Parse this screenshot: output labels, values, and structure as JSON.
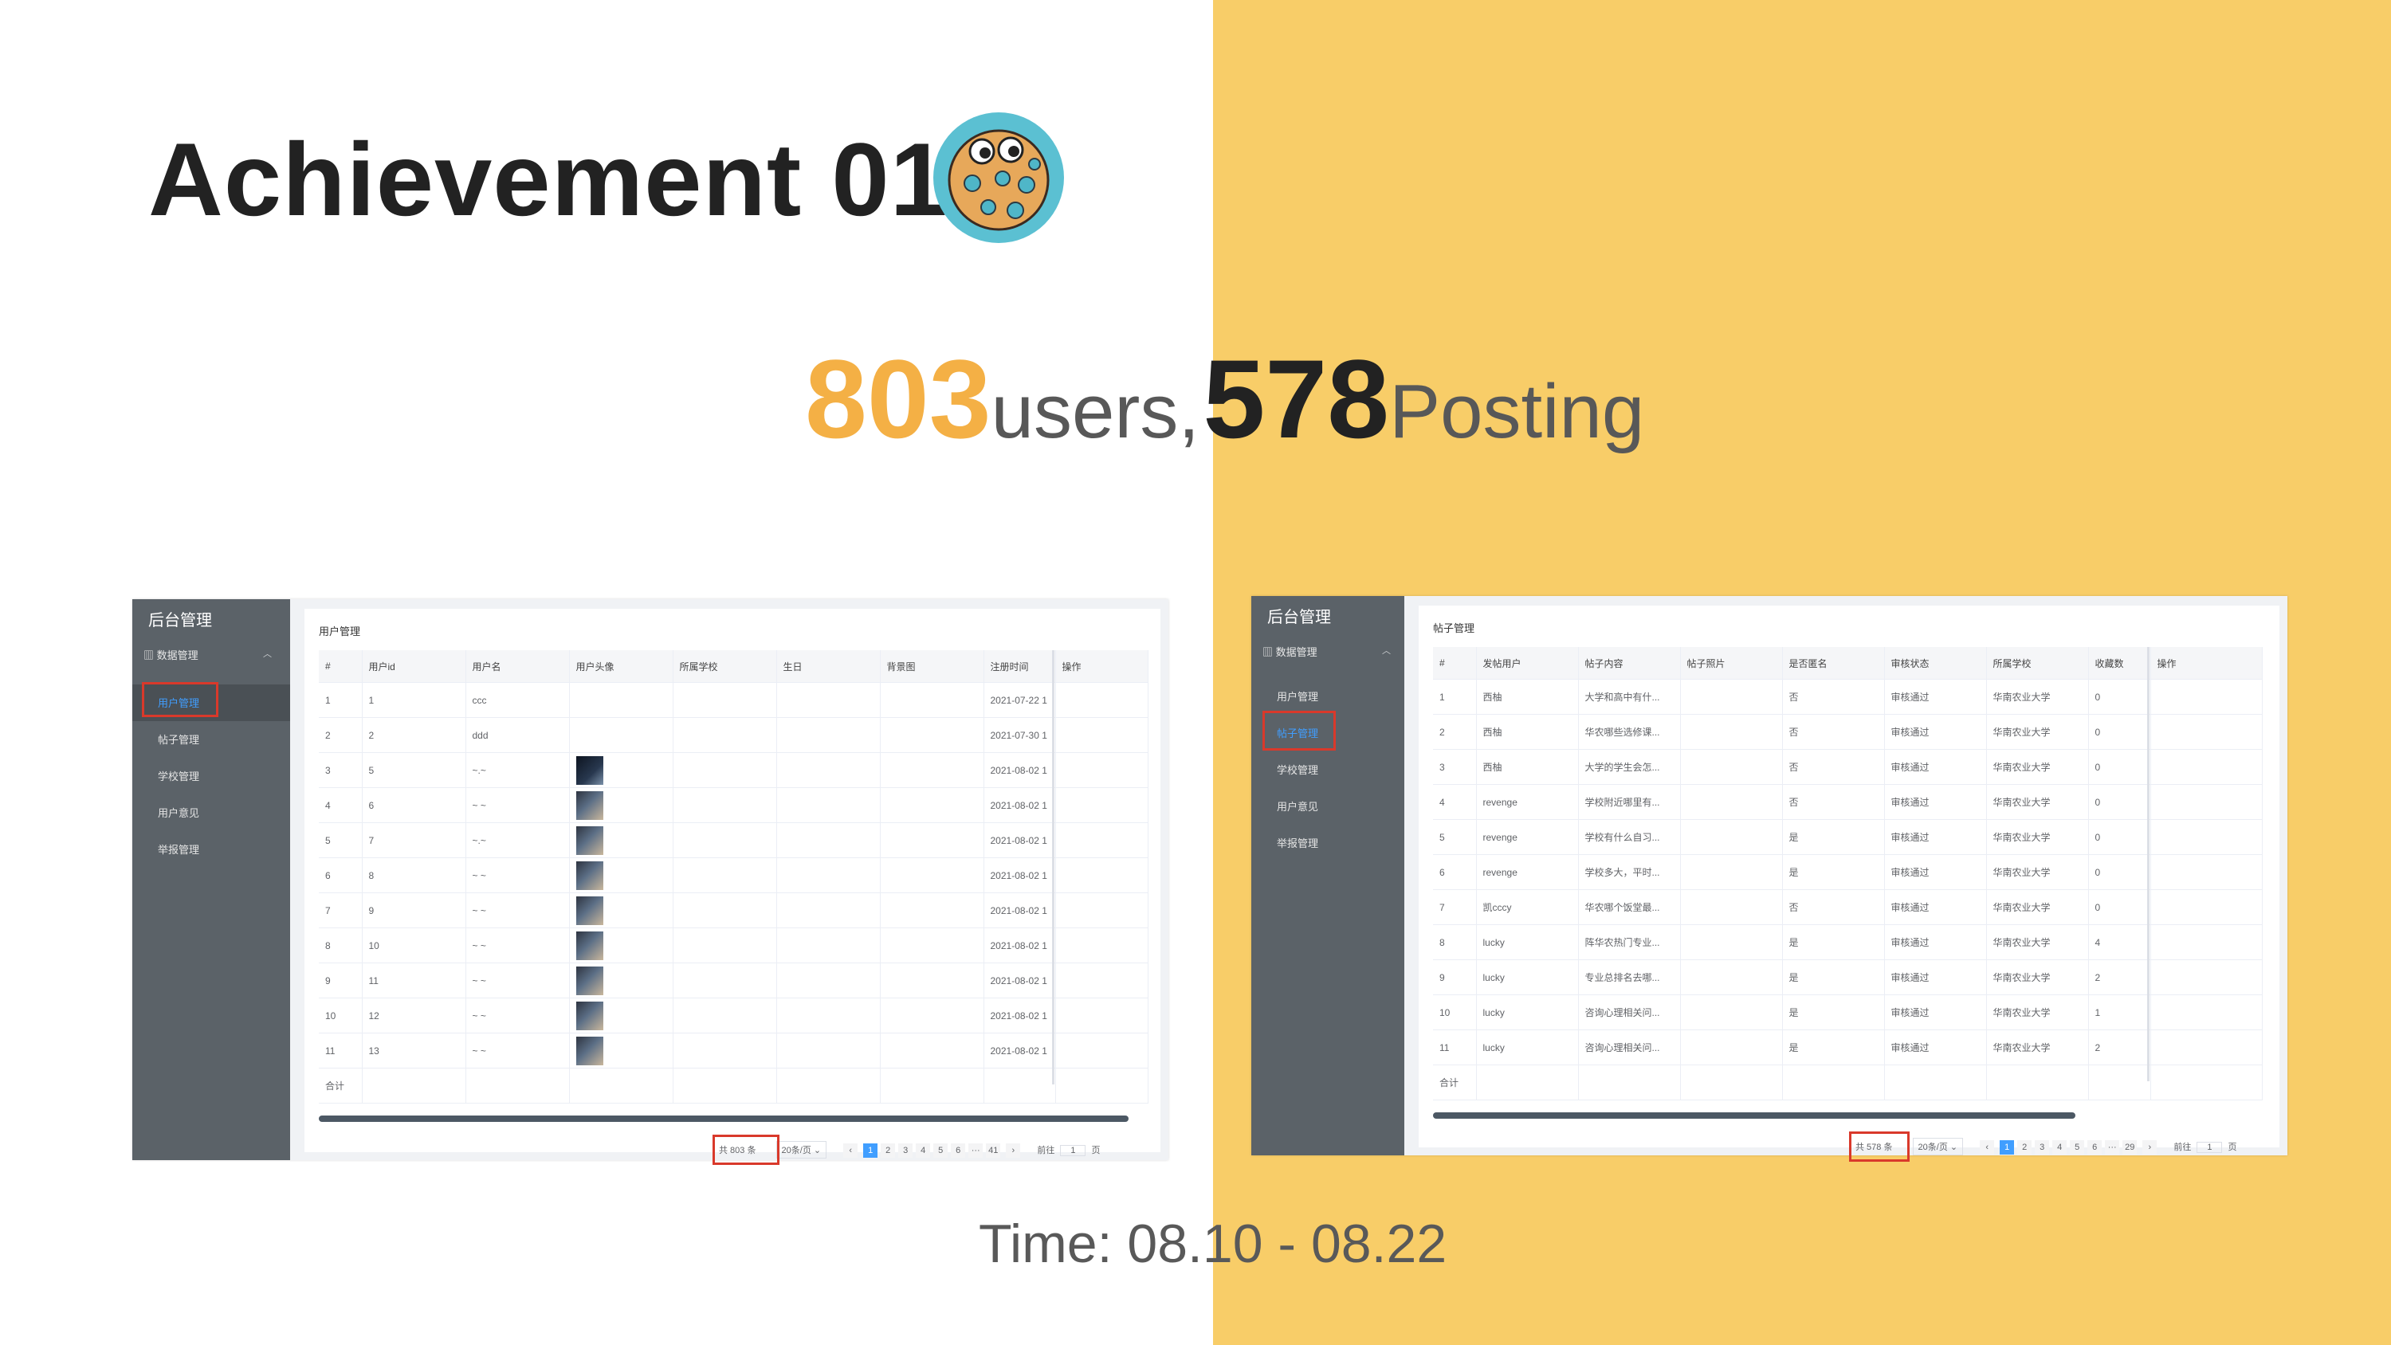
{
  "slide": {
    "title": "Achievement 01",
    "stat_users_value": "803",
    "stat_users_label": " users,",
    "stat_posts_value": "578",
    "stat_posts_label": "Posting",
    "time": "Time: 08.10 - 08.22"
  },
  "colors": {
    "accent_orange": "#f4b045",
    "bg_yellow": "#f8cd68",
    "sidebar": "#5b6268",
    "link_blue": "#409eff",
    "highlight_red": "#d9392b"
  },
  "user_panel": {
    "app_title": "后台管理",
    "group": "数据管理",
    "menu": [
      "用户管理",
      "帖子管理",
      "学校管理",
      "用户意见",
      "举报管理"
    ],
    "page_title": "用户管理",
    "columns": [
      "#",
      "用户id",
      "用户名",
      "用户头像",
      "所属学校",
      "生日",
      "背景图",
      "注册时间",
      "操作"
    ],
    "rows": [
      {
        "n": "1",
        "id": "1",
        "name": "ccc",
        "avatar": "",
        "time": "2021-07-22 1"
      },
      {
        "n": "2",
        "id": "2",
        "name": "ddd",
        "avatar": "",
        "time": "2021-07-30 1"
      },
      {
        "n": "3",
        "id": "5",
        "name": "~.~",
        "avatar": "dark",
        "time": "2021-08-02 1"
      },
      {
        "n": "4",
        "id": "6",
        "name": "~ ~",
        "avatar": "img",
        "time": "2021-08-02 1"
      },
      {
        "n": "5",
        "id": "7",
        "name": "~.~",
        "avatar": "img",
        "time": "2021-08-02 1"
      },
      {
        "n": "6",
        "id": "8",
        "name": "~ ~",
        "avatar": "img",
        "time": "2021-08-02 1"
      },
      {
        "n": "7",
        "id": "9",
        "name": "~ ~",
        "avatar": "img",
        "time": "2021-08-02 1"
      },
      {
        "n": "8",
        "id": "10",
        "name": "~ ~",
        "avatar": "img",
        "time": "2021-08-02 1"
      },
      {
        "n": "9",
        "id": "11",
        "name": "~ ~",
        "avatar": "img",
        "time": "2021-08-02 1"
      },
      {
        "n": "10",
        "id": "12",
        "name": "~ ~",
        "avatar": "img",
        "time": "2021-08-02 1"
      },
      {
        "n": "11",
        "id": "13",
        "name": "~ ~",
        "avatar": "img",
        "time": "2021-08-02 1"
      }
    ],
    "total_row": "合计",
    "pager": {
      "total": "共 803 条",
      "size": "20条/页",
      "pages": [
        "1",
        "2",
        "3",
        "4",
        "5",
        "6",
        "···",
        "41"
      ],
      "goto": "前往",
      "page_input": "1",
      "page_suffix": "页",
      "prev": "‹",
      "next": "›"
    }
  },
  "post_panel": {
    "app_title": "后台管理",
    "group": "数据管理",
    "menu": [
      "用户管理",
      "帖子管理",
      "学校管理",
      "用户意见",
      "举报管理"
    ],
    "page_title": "帖子管理",
    "columns": [
      "#",
      "发帖用户",
      "帖子内容",
      "帖子照片",
      "是否匿名",
      "审核状态",
      "所属学校",
      "收藏数",
      "操作"
    ],
    "rows": [
      {
        "n": "1",
        "user": "西柚",
        "content": "大学和高中有什...",
        "anon": "否",
        "status": "审核通过",
        "school": "华南农业大学",
        "fav": "0"
      },
      {
        "n": "2",
        "user": "西柚",
        "content": "华农哪些选修课...",
        "anon": "否",
        "status": "审核通过",
        "school": "华南农业大学",
        "fav": "0"
      },
      {
        "n": "3",
        "user": "西柚",
        "content": "大学的学生会怎...",
        "anon": "否",
        "status": "审核通过",
        "school": "华南农业大学",
        "fav": "0"
      },
      {
        "n": "4",
        "user": "revenge",
        "content": "学校附近哪里有...",
        "anon": "否",
        "status": "审核通过",
        "school": "华南农业大学",
        "fav": "0"
      },
      {
        "n": "5",
        "user": "revenge",
        "content": "学校有什么自习...",
        "anon": "是",
        "status": "审核通过",
        "school": "华南农业大学",
        "fav": "0"
      },
      {
        "n": "6",
        "user": "revenge",
        "content": "学校多大，平时...",
        "anon": "是",
        "status": "审核通过",
        "school": "华南农业大学",
        "fav": "0"
      },
      {
        "n": "7",
        "user": "凯cccy",
        "content": "华农哪个饭堂最...",
        "anon": "否",
        "status": "审核通过",
        "school": "华南农业大学",
        "fav": "0"
      },
      {
        "n": "8",
        "user": "lucky",
        "content": "阵华农热门专业...",
        "anon": "是",
        "status": "审核通过",
        "school": "华南农业大学",
        "fav": "4"
      },
      {
        "n": "9",
        "user": "lucky",
        "content": "专业总排名去哪...",
        "anon": "是",
        "status": "审核通过",
        "school": "华南农业大学",
        "fav": "2"
      },
      {
        "n": "10",
        "user": "lucky",
        "content": "咨询心理相关问...",
        "anon": "是",
        "status": "审核通过",
        "school": "华南农业大学",
        "fav": "1"
      },
      {
        "n": "11",
        "user": "lucky",
        "content": "咨询心理相关问...",
        "anon": "是",
        "status": "审核通过",
        "school": "华南农业大学",
        "fav": "2"
      }
    ],
    "total_row": "合计",
    "pager": {
      "total": "共 578 条",
      "size": "20条/页",
      "pages": [
        "1",
        "2",
        "3",
        "4",
        "5",
        "6",
        "···",
        "29"
      ],
      "goto": "前往",
      "page_input": "1",
      "page_suffix": "页",
      "prev": "‹",
      "next": "›"
    }
  }
}
